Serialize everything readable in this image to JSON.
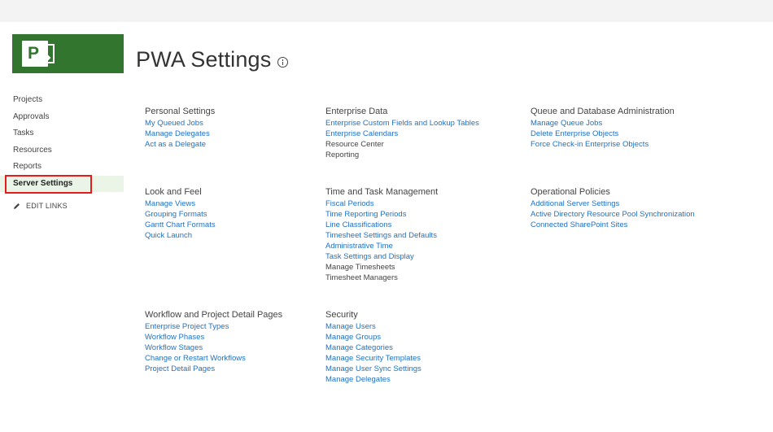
{
  "page": {
    "title": "PWA Settings"
  },
  "leftnav": {
    "items": [
      {
        "label": "Projects"
      },
      {
        "label": "Approvals"
      },
      {
        "label": "Tasks"
      },
      {
        "label": "Resources"
      },
      {
        "label": "Reports"
      },
      {
        "label": "Server Settings"
      }
    ],
    "edit_links": "EDIT LINKS"
  },
  "groups": {
    "personal": {
      "title": "Personal Settings",
      "links": [
        "My Queued Jobs",
        "Manage Delegates",
        "Act as a Delegate"
      ]
    },
    "enterprise": {
      "title": "Enterprise Data",
      "links": [
        "Enterprise Custom Fields and Lookup Tables",
        "Enterprise Calendars",
        "Resource Center",
        "Reporting"
      ]
    },
    "queue": {
      "title": "Queue and Database Administration",
      "links": [
        "Manage Queue Jobs",
        "Delete Enterprise Objects",
        "Force Check-in Enterprise Objects"
      ]
    },
    "look": {
      "title": "Look and Feel",
      "links": [
        "Manage Views",
        "Grouping Formats",
        "Gantt Chart Formats",
        "Quick Launch"
      ]
    },
    "time": {
      "title": "Time and Task Management",
      "links": [
        "Fiscal Periods",
        "Time Reporting Periods",
        "Line Classifications",
        "Timesheet Settings and Defaults",
        "Administrative Time",
        "Task Settings and Display",
        "Manage Timesheets",
        "Timesheet Managers"
      ]
    },
    "operational": {
      "title": "Operational Policies",
      "links": [
        "Additional Server Settings",
        "Active Directory Resource Pool Synchronization",
        "Connected SharePoint Sites"
      ]
    },
    "workflow": {
      "title": "Workflow and Project Detail Pages",
      "links": [
        "Enterprise Project Types",
        "Workflow Phases",
        "Workflow Stages",
        "Change or Restart Workflows",
        "Project Detail Pages"
      ]
    },
    "security": {
      "title": "Security",
      "links": [
        "Manage Users",
        "Manage Groups",
        "Manage Categories",
        "Manage Security Templates",
        "Manage User Sync Settings",
        "Manage Delegates"
      ]
    }
  },
  "colors": {
    "brand": "#31752f",
    "link": "#2072c5",
    "selected_bg": "#eaf5e7",
    "highlight_border": "#e41c1c"
  },
  "icons": {
    "logo": "project-logo-icon",
    "info": "info-icon",
    "edit": "pencil-icon"
  }
}
